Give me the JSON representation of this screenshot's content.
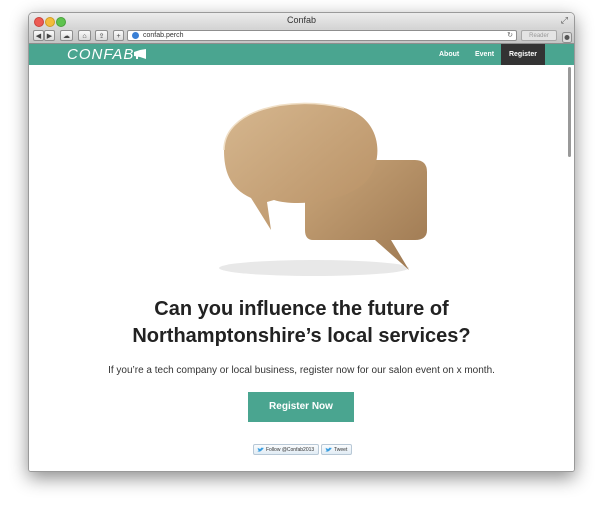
{
  "window": {
    "title": "Confab",
    "url": "confab.perch",
    "reader_label": "Reader"
  },
  "site": {
    "logo_text": "CONFAB",
    "nav": [
      {
        "label": "About"
      },
      {
        "label": "Event"
      },
      {
        "label": "Register"
      }
    ]
  },
  "hero": {
    "headline_line1": "Can you influence the future of",
    "headline_line2": "Northamptonshire’s local services?",
    "subtext": "If you’re a tech company or local business, register now for our salon event on x month.",
    "cta_label": "Register Now"
  },
  "social": {
    "follow_label": "Follow @Confab2013",
    "tweet_label": "Tweet"
  },
  "colors": {
    "brand_teal": "#4aa590",
    "nav_active": "#333333",
    "text": "#222222"
  }
}
